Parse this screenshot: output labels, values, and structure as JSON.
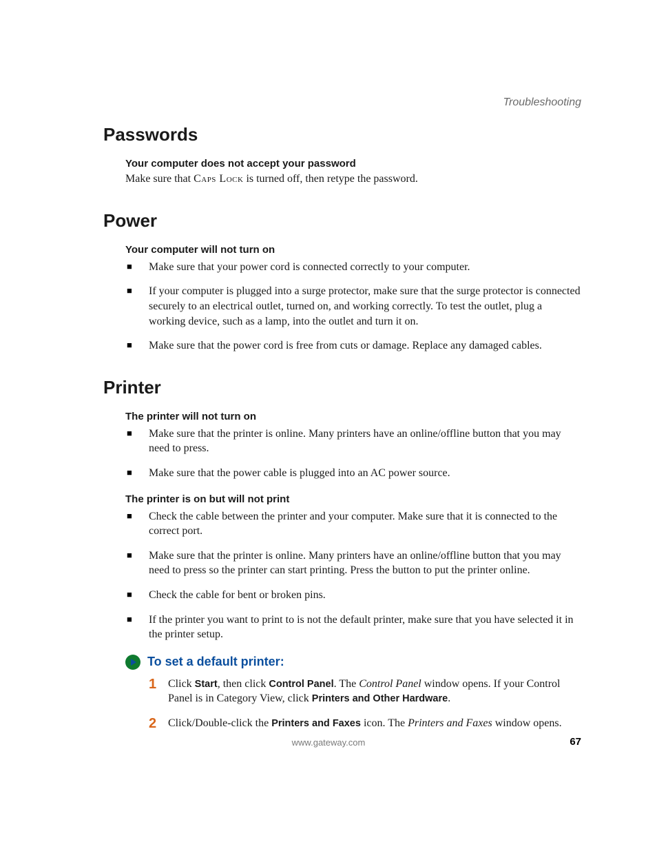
{
  "chapter": "Troubleshooting",
  "sections": {
    "passwords": {
      "heading": "Passwords",
      "sub1": {
        "title": "Your computer does not accept your password",
        "text_pre": "Make sure that ",
        "caps": "Caps Lock",
        "text_post": " is turned off, then retype the password."
      }
    },
    "power": {
      "heading": "Power",
      "sub1": {
        "title": "Your computer will not turn on",
        "bullets": [
          "Make sure that your power cord is connected correctly to your computer.",
          "If your computer is plugged into a surge protector, make sure that the surge protector is connected securely to an electrical outlet, turned on, and working correctly. To test the outlet, plug a working device, such as a lamp, into the outlet and turn it on.",
          "Make sure that the power cord is free from cuts or damage. Replace any damaged cables."
        ]
      }
    },
    "printer": {
      "heading": "Printer",
      "sub1": {
        "title": "The printer will not turn on",
        "bullets": [
          "Make sure that the printer is online. Many printers have an online/offline button that you may need to press.",
          "Make sure that the power cable is plugged into an AC power source."
        ]
      },
      "sub2": {
        "title": "The printer is on but will not print",
        "bullets": [
          "Check the cable between the printer and your computer. Make sure that it is connected to the correct port.",
          "Make sure that the printer is online. Many printers have an online/offline button that you may need to press so the printer can start printing. Press the button to put the printer online.",
          "Check the cable for bent or broken pins.",
          "If the printer you want to print to is not the default printer, make sure that you have selected it in the printer setup."
        ]
      },
      "procedure": {
        "title": "To set a default printer:",
        "steps": {
          "s1": {
            "t1": "Click ",
            "b1": "Start",
            "t2": ", then click ",
            "b2": "Control Panel",
            "t3": ". The ",
            "i1": "Control Panel",
            "t4": " window opens. If your Control Panel is in Category View, click ",
            "b3": "Printers and Other Hardware",
            "t5": "."
          },
          "s2": {
            "t1": "Click/Double-click the ",
            "b1": "Printers and Faxes",
            "t2": " icon. The ",
            "i1": "Printers and Faxes",
            "t3": " window opens."
          }
        }
      }
    }
  },
  "footer_url": "www.gateway.com",
  "page_number": "67"
}
